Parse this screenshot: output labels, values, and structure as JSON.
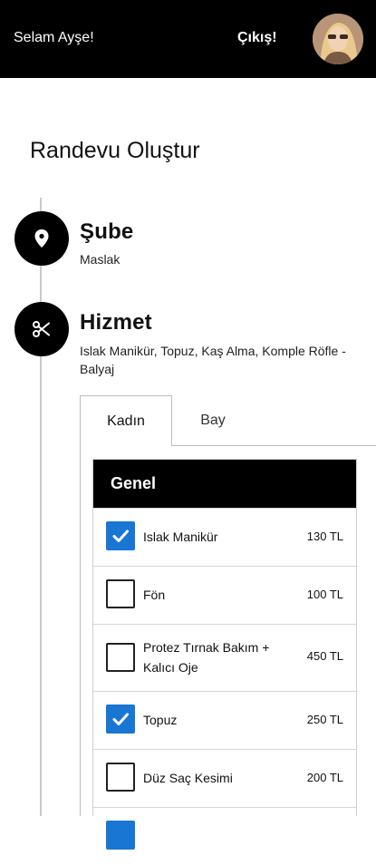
{
  "header": {
    "greeting": "Selam Ayşe!",
    "logout_label": "Çıkış!"
  },
  "page": {
    "title": "Randevu Oluştur"
  },
  "steps": [
    {
      "icon": "location-pin-icon",
      "title": "Şube",
      "value": "Maslak"
    },
    {
      "icon": "scissors-icon",
      "title": "Hizmet",
      "value": "Islak Manikür, Topuz, Kaş Alma, Komple Röfle - Balyaj"
    }
  ],
  "tabs": [
    {
      "label": "Kadın",
      "active": true
    },
    {
      "label": "Bay",
      "active": false
    }
  ],
  "category": {
    "title": "Genel"
  },
  "services": [
    {
      "name": "Islak Manikür",
      "price": "130 TL",
      "checked": true
    },
    {
      "name": "Fön",
      "price": "100 TL",
      "checked": false
    },
    {
      "name": "Protez Tırnak Bakım + Kalıcı Oje",
      "price": "450 TL",
      "checked": false
    },
    {
      "name": "Topuz",
      "price": "250 TL",
      "checked": true
    },
    {
      "name": "Düz Saç Kesimi",
      "price": "200 TL",
      "checked": false
    }
  ],
  "colors": {
    "header_bg": "#000000",
    "checkbox_checked": "#1976d2",
    "rail": "#c9c9c9"
  }
}
